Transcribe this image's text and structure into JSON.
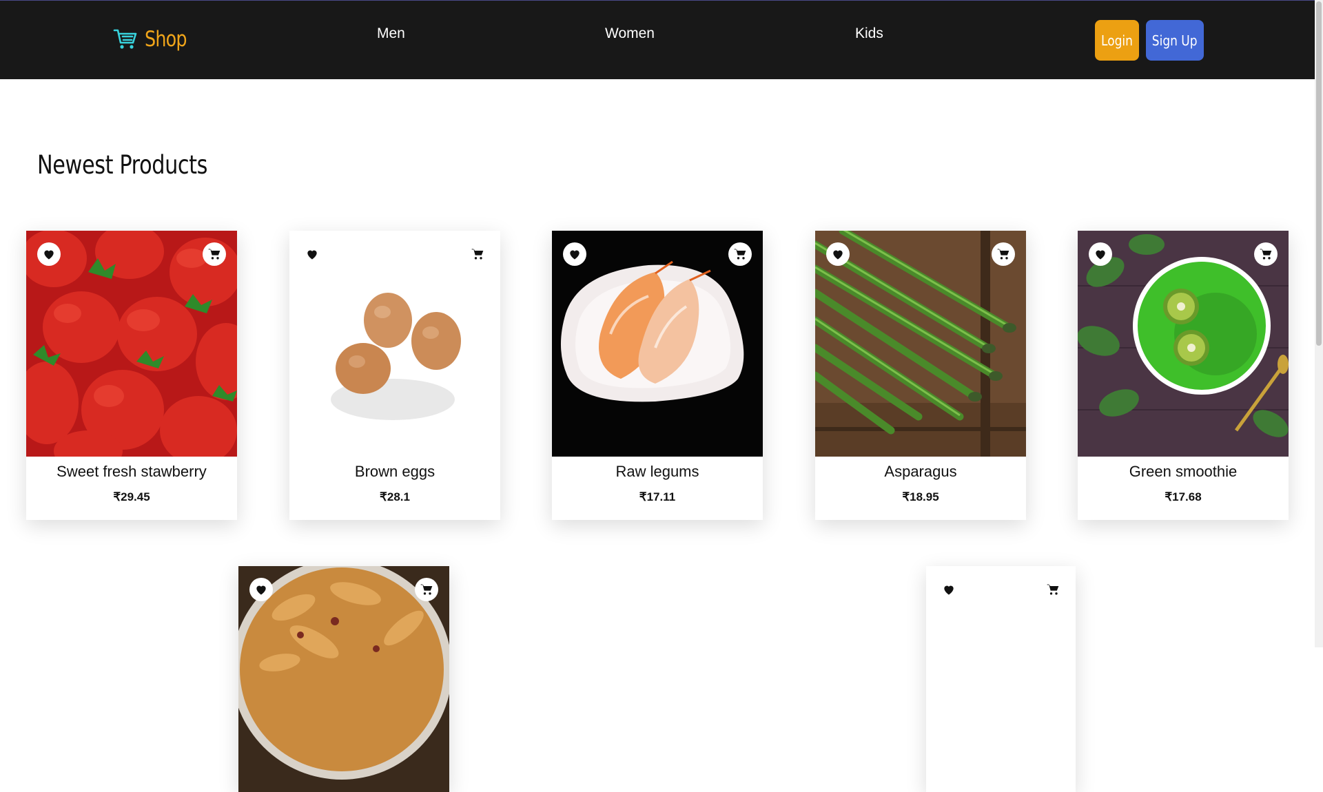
{
  "brand": {
    "name": "Shop",
    "icon": "cart-icon",
    "color": "#f0a51a"
  },
  "nav": {
    "links": [
      "Men",
      "Women",
      "Kids"
    ]
  },
  "auth": {
    "login_label": "Login",
    "signup_label": "Sign Up",
    "login_color": "#eca012",
    "signup_color": "#4268d6"
  },
  "section": {
    "title": "Newest Products"
  },
  "products": [
    {
      "name": "Sweet fresh stawberry",
      "price": "₹29.45",
      "image": "strawberries"
    },
    {
      "name": "Brown eggs",
      "price": "₹28.1",
      "image": "eggs"
    },
    {
      "name": "Raw legums",
      "price": "₹17.11",
      "image": "shrimp-sushi"
    },
    {
      "name": "Asparagus",
      "price": "₹18.95",
      "image": "asparagus"
    },
    {
      "name": "Green smoothie",
      "price": "₹17.68",
      "image": "green-smoothie"
    },
    {
      "name": "",
      "price": "",
      "image": "pie"
    },
    {
      "name": "",
      "price": "",
      "image": "blank"
    }
  ]
}
